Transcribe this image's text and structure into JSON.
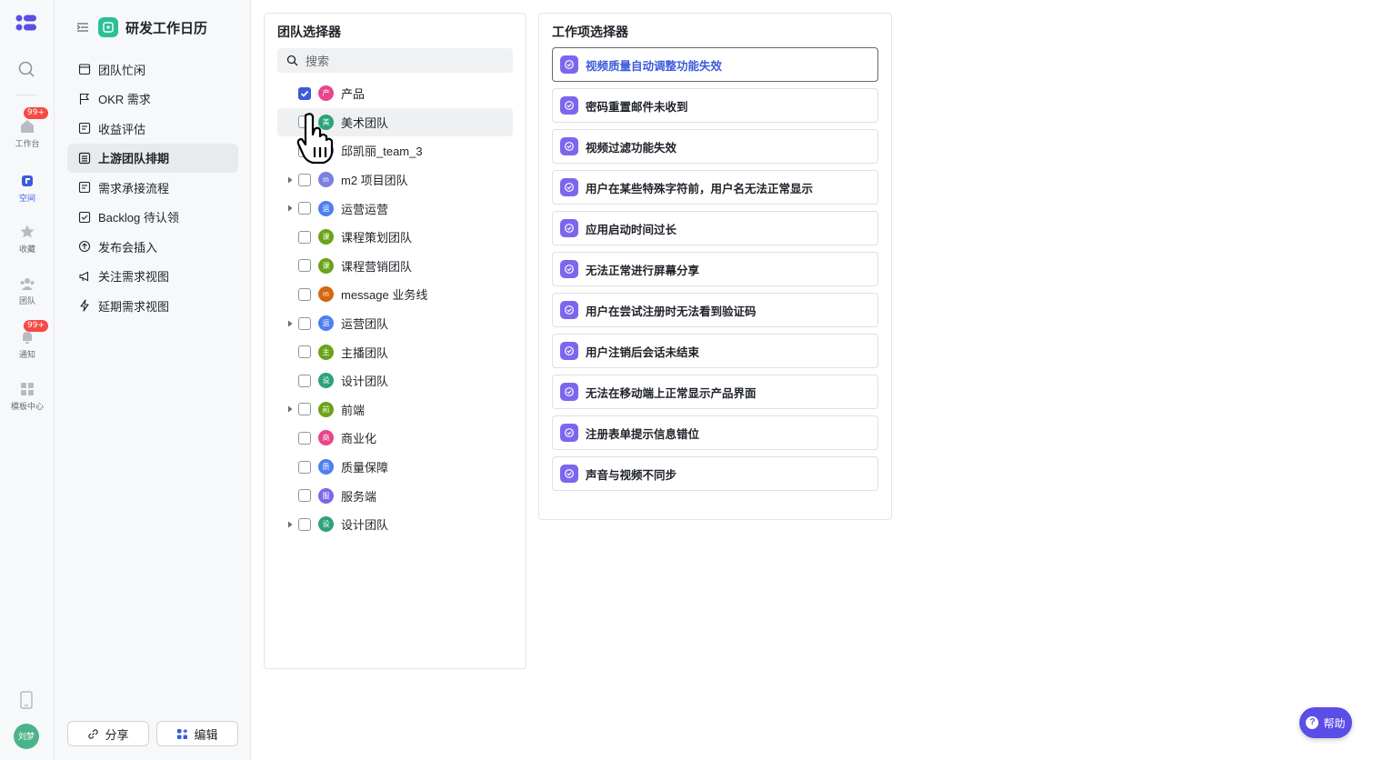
{
  "rail": {
    "items": [
      {
        "label": "工作台",
        "badge": "99+"
      },
      {
        "label": "空间"
      },
      {
        "label": "收藏"
      },
      {
        "label": "团队"
      },
      {
        "label": "通知",
        "badge": "99+"
      },
      {
        "label": "模板中心"
      }
    ],
    "user_avatar": "刘梦"
  },
  "nav": {
    "space_title": "研发工作日历",
    "items": [
      {
        "label": "团队忙闲"
      },
      {
        "label": "OKR 需求"
      },
      {
        "label": "收益评估"
      },
      {
        "label": "上游团队排期"
      },
      {
        "label": "需求承接流程"
      },
      {
        "label": "Backlog 待认领"
      },
      {
        "label": "发布会插入"
      },
      {
        "label": "关注需求视图"
      },
      {
        "label": "延期需求视图"
      }
    ],
    "share_label": "分享",
    "edit_label": "编辑"
  },
  "team_selector": {
    "title": "团队选择器",
    "search_placeholder": "搜索",
    "teams": [
      {
        "name": "产品",
        "avatar": "产",
        "color": "#e8458b",
        "checked": true,
        "expandable": false
      },
      {
        "name": "美术团队",
        "avatar": "美",
        "color": "#2ea37a",
        "checked": false,
        "expandable": false
      },
      {
        "name": "邱凯丽_team_3",
        "avatar": "邱",
        "color": "#3b7fe0",
        "checked": false,
        "expandable": false
      },
      {
        "name": "m2 项目团队",
        "avatar": "m",
        "color": "#7b7fe0",
        "checked": false,
        "expandable": true
      },
      {
        "name": "运营运营",
        "avatar": "运",
        "color": "#4d7ff0",
        "checked": false,
        "expandable": true
      },
      {
        "name": "课程策划团队",
        "avatar": "课",
        "color": "#6aa31a",
        "checked": false,
        "expandable": false
      },
      {
        "name": "课程营销团队",
        "avatar": "课",
        "color": "#6aa31a",
        "checked": false,
        "expandable": false
      },
      {
        "name": "message 业务线",
        "avatar": "m",
        "color": "#d6660f",
        "checked": false,
        "expandable": false
      },
      {
        "name": "运营团队",
        "avatar": "运",
        "color": "#4d7ff0",
        "checked": false,
        "expandable": true
      },
      {
        "name": "主播团队",
        "avatar": "主",
        "color": "#6aa31a",
        "checked": false,
        "expandable": false
      },
      {
        "name": "设计团队",
        "avatar": "设",
        "color": "#2ea37a",
        "checked": false,
        "expandable": false
      },
      {
        "name": "前端",
        "avatar": "前",
        "color": "#6aa31a",
        "checked": false,
        "expandable": true
      },
      {
        "name": "商业化",
        "avatar": "商",
        "color": "#e8458b",
        "checked": false,
        "expandable": false
      },
      {
        "name": "质量保障",
        "avatar": "质",
        "color": "#4d7ff0",
        "checked": false,
        "expandable": false
      },
      {
        "name": "服务端",
        "avatar": "服",
        "color": "#7b67ee",
        "checked": false,
        "expandable": false
      },
      {
        "name": "设计团队",
        "avatar": "设",
        "color": "#2ea37a",
        "checked": false,
        "expandable": true
      }
    ]
  },
  "work_selector": {
    "title": "工作项选择器",
    "items": [
      {
        "label": "视频质量自动调整功能失效",
        "selected": true
      },
      {
        "label": "密码重置邮件未收到"
      },
      {
        "label": "视频过滤功能失效"
      },
      {
        "label": "用户在某些特殊字符前，用户名无法正常显示"
      },
      {
        "label": "应用启动时间过长"
      },
      {
        "label": "无法正常进行屏幕分享"
      },
      {
        "label": "用户在尝试注册时无法看到验证码"
      },
      {
        "label": "用户注销后会话未结束"
      },
      {
        "label": "无法在移动端上正常显示产品界面"
      },
      {
        "label": "注册表单提示信息错位"
      },
      {
        "label": "声音与视频不同步"
      },
      {
        "label": ""
      }
    ]
  },
  "help": {
    "label": "帮助"
  },
  "colors": {
    "accent": "#3b5bdb",
    "work_icon": "#7b67ee",
    "help_bg": "#5b4ee6",
    "space_icon": "#2ac096"
  }
}
